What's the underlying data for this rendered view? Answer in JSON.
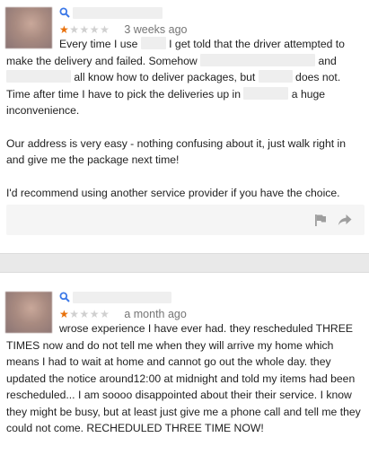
{
  "reviews": [
    {
      "date": "3 weeks ago",
      "rating": 1,
      "max_rating": 5,
      "paragraphs": [
        {
          "segments": [
            {
              "t": "Every time I use "
            },
            {
              "blur": 28
            },
            {
              "t": " I get told that the driver attempted to make the delivery and failed. Somehow "
            },
            {
              "blur": 128
            },
            {
              "t": " and "
            },
            {
              "blur": 72
            },
            {
              "t": " all know how to deliver packages, but "
            },
            {
              "blur": 38
            },
            {
              "t": " does not. Time after time I have to pick the deliveries up in "
            },
            {
              "blur": 50
            },
            {
              "t": " a huge inconvenience."
            }
          ]
        },
        {
          "plain": true,
          "segments": [
            {
              "t": "Our address is very easy - nothing confusing about it, just walk right in and give me the package next time!"
            }
          ]
        },
        {
          "plain": true,
          "segments": [
            {
              "t": "I'd recommend using another service provider if you have the choice."
            }
          ]
        }
      ],
      "actions": {
        "flag": "flag-icon",
        "share": "share-icon"
      }
    },
    {
      "date": "a month ago",
      "rating": 1,
      "max_rating": 5,
      "paragraphs": [
        {
          "segments": [
            {
              "t": "wrose experience I have ever had. they rescheduled THREE TIMES now and do not tell me when they will arrive my home which means I had to wait at home and cannot go out the whole day. they updated the notice around12:00 at midnight and told my items had been rescheduled... I am soooo disappointed about their their service. I know they might be busy, but at least just give me a phone call and tell me they could not come. RECHEDULED THREE TIME NOW!"
            }
          ]
        }
      ]
    }
  ],
  "colors": {
    "star_filled": "#e8700a",
    "star_empty": "#d0d0d0",
    "separator": "#e9e9e9"
  }
}
